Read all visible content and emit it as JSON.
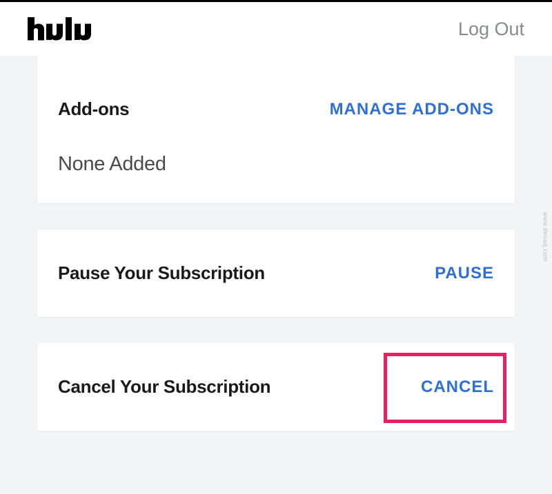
{
  "header": {
    "logo_text": "hulu",
    "logout_label": "Log Out"
  },
  "addons": {
    "title": "Add-ons",
    "manage_label": "MANAGE ADD-ONS",
    "body": "None Added"
  },
  "pause": {
    "title": "Pause Your Subscription",
    "action_label": "PAUSE"
  },
  "cancel": {
    "title": "Cancel Your Subscription",
    "action_label": "CANCEL"
  },
  "watermark": "www.deuaq.com"
}
